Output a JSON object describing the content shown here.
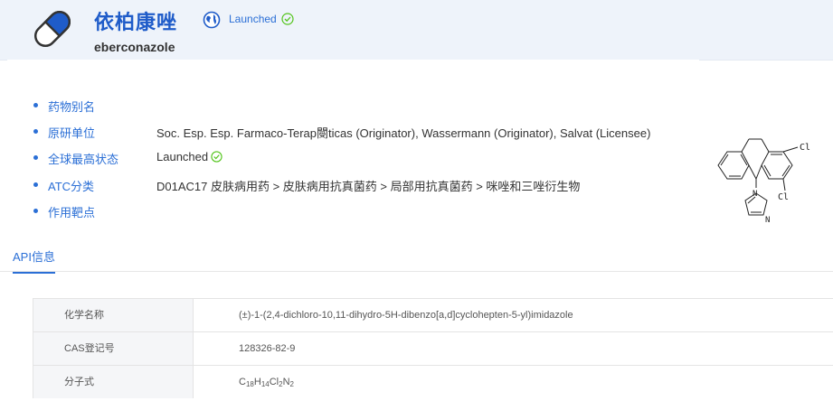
{
  "drug": {
    "name_cn": "依柏康唑",
    "name_en": "eberconazole",
    "status": "Launched"
  },
  "info": [
    {
      "label": "药物别名",
      "value": ""
    },
    {
      "label": "原研单位",
      "value": "Soc. Esp. Esp. Farmaco-Terap閿ticas (Originator), Wassermann (Originator), Salvat (Licensee)"
    },
    {
      "label": "全球最高状态",
      "value": "Launched"
    },
    {
      "label": "ATC分类",
      "value": "D01AC17  皮肤病用药 > 皮肤病用抗真菌药 > 局部用抗真菌药 > 咪唑和三唑衍生物"
    },
    {
      "label": "作用靶点",
      "value": ""
    }
  ],
  "structure": {
    "cl_top": "Cl",
    "cl_bottom": "Cl",
    "n1": "N",
    "n2": "N"
  },
  "tabs": {
    "api": "API信息"
  },
  "api_table": {
    "rows": [
      {
        "label": "化学名称",
        "value": "(±)-1-(2,4-dichloro-10,11-dihydro-5H-dibenzo[a,d]cyclohepten-5-yl)imidazole"
      },
      {
        "label": "CAS登记号",
        "value": "128326-82-9"
      },
      {
        "label": "分子式",
        "value": "C18H14Cl2N2"
      }
    ],
    "formula_parts": {
      "c": "C",
      "c_n": "18",
      "h": "H",
      "h_n": "14",
      "cl": "Cl",
      "cl_n": "2",
      "n": "N",
      "n_n": "2"
    }
  },
  "icons": {
    "logo": "capsule-icon",
    "globe": "globe-icon",
    "check": "check-circle-icon"
  },
  "colors": {
    "accent": "#2b6fd6",
    "title": "#1f5cc9",
    "success": "#52c41a",
    "header_bg": "#eef3fa"
  }
}
